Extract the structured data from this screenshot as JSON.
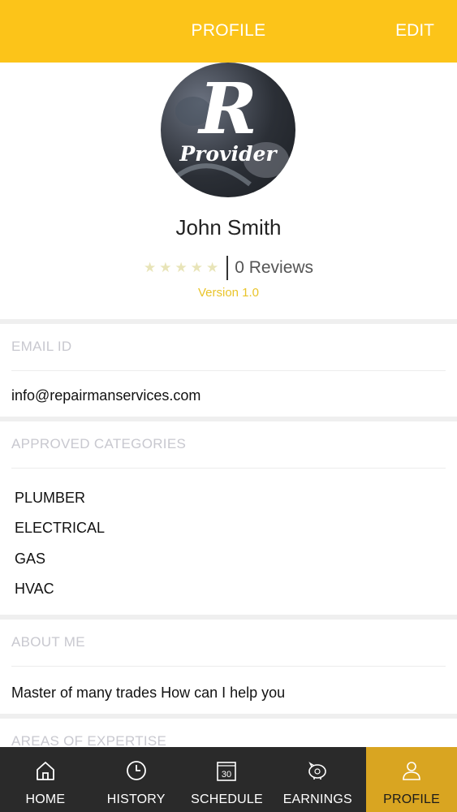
{
  "header": {
    "title": "PROFILE",
    "edit_label": "EDIT"
  },
  "colors": {
    "accent": "#fcc419",
    "active_nav": "#d9a521",
    "nav_bg": "#2a2a2a"
  },
  "profile": {
    "avatar_letter": "R",
    "avatar_subtitle": "Provider",
    "name": "John Smith",
    "rating": 0,
    "max_rating": 5,
    "reviews": "0 Reviews",
    "version": "Version 1.0"
  },
  "email": {
    "label": "EMAIL ID",
    "value": "info@repairmanservices.com"
  },
  "categories": {
    "label": "APPROVED CATEGORIES",
    "items": [
      "PLUMBER",
      "ELECTRICAL",
      "GAS",
      "HVAC"
    ]
  },
  "about": {
    "label": "ABOUT ME",
    "value": "Master of many trades How can I help you"
  },
  "expertise": {
    "label": "AREAS OF EXPERTISE"
  },
  "nav": {
    "items": [
      {
        "label": "HOME",
        "icon": "home-icon"
      },
      {
        "label": "HISTORY",
        "icon": "clock-icon"
      },
      {
        "label": "SCHEDULE",
        "icon": "calendar-icon",
        "icon_text": "30"
      },
      {
        "label": "EARNINGS",
        "icon": "piggy-bank-icon"
      },
      {
        "label": "PROFILE",
        "icon": "person-icon",
        "active": true
      }
    ]
  }
}
